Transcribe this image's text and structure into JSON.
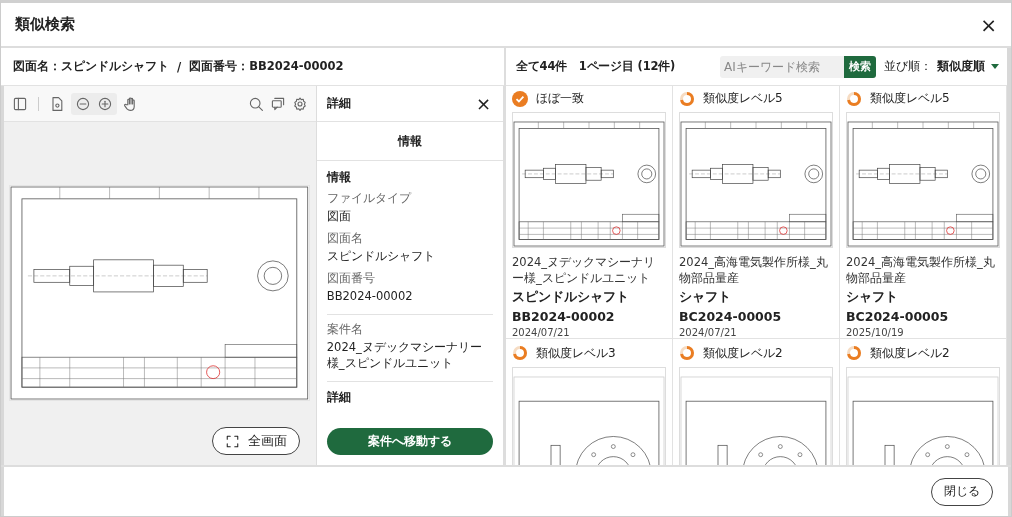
{
  "dialog": {
    "title": "類似検索",
    "close": "×"
  },
  "drawing_header": {
    "name_label": "図面名：スピンドルシャフト",
    "separator": "/",
    "number_label": "図面番号：BB2024-00002"
  },
  "viewer": {
    "fullscreen_button": "全画面"
  },
  "detail": {
    "title": "詳細",
    "close": "×",
    "tabs": [
      {
        "label": "情報",
        "selected": true
      }
    ],
    "heading": "情報",
    "groups": [
      {
        "fields": [
          {
            "label": "ファイルタイプ",
            "value": "図面"
          },
          {
            "label": "図面名",
            "value": "スピンドルシャフト"
          },
          {
            "label": "図面番号",
            "value": "BB2024-00002"
          }
        ]
      },
      {
        "fields": [
          {
            "label": "案件名",
            "value": "2024_ヌデックマシーナリー様_スピンドルユニット"
          }
        ]
      }
    ],
    "next_heading": "詳細",
    "action_button": "案件へ移動する"
  },
  "results": {
    "summary": "全て44件　1ページ目 (12件)",
    "search": {
      "placeholder": "AIキーワード検索",
      "button": "検索"
    },
    "sort": {
      "label": "並び順：",
      "value": "類似度順"
    },
    "items": [
      {
        "similarity": "ほぼ一致",
        "exact": true,
        "kind": "shaft",
        "project": "2024_ヌデックマシーナリー様_スピンドルユニット",
        "name": "スピンドルシャフト",
        "number": "BB2024-00002",
        "date": "2024/07/21"
      },
      {
        "similarity": "類似度レベル5",
        "exact": false,
        "kind": "shaft",
        "project": "2024_高海電気製作所様_丸物部品量産",
        "name": "シャフト",
        "number": "BC2024-00005",
        "date": "2024/07/21"
      },
      {
        "similarity": "類似度レベル5",
        "exact": false,
        "kind": "shaft",
        "project": "2024_高海電気製作所様_丸物部品量産",
        "name": "シャフト",
        "number": "BC2024-00005",
        "date": "2025/10/19"
      },
      {
        "similarity": "類似度レベル3",
        "exact": false,
        "kind": "flange"
      },
      {
        "similarity": "類似度レベル2",
        "exact": false,
        "kind": "flange"
      },
      {
        "similarity": "類似度レベル2",
        "exact": false,
        "kind": "flange"
      }
    ]
  },
  "footer": {
    "close_button": "閉じる"
  }
}
